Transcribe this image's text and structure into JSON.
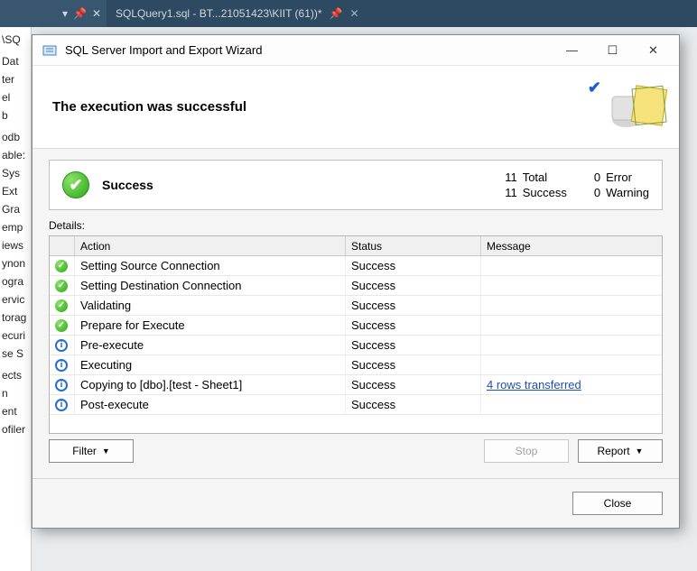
{
  "tabstrip": {
    "tab_label": "SQLQuery1.sql - BT...21051423\\KIIT (61))*"
  },
  "left_tree_fragments": [
    "\\SQ",
    "",
    "Dat",
    "ter",
    "el",
    "b",
    "",
    "odb",
    "able:",
    "Sys",
    "Ext",
    "Gra",
    "emp",
    "iews",
    "ynon",
    "ogra",
    "ervic",
    "torag",
    "ecuri",
    "se S",
    "",
    "ects",
    "n",
    "ent",
    "ofiler"
  ],
  "dialog": {
    "title": "SQL Server Import and Export Wizard",
    "banner_headline": "The execution was successful",
    "summary": {
      "label": "Success",
      "total_n": "11",
      "total_lbl": "Total",
      "success_n": "11",
      "success_lbl": "Success",
      "error_n": "0",
      "error_lbl": "Error",
      "warning_n": "0",
      "warning_lbl": "Warning"
    },
    "details_label": "Details:",
    "columns": {
      "c0": "",
      "c1": "Action",
      "c2": "Status",
      "c3": "Message"
    },
    "rows": [
      {
        "icon": "ok",
        "action": "Setting Source Connection",
        "status": "Success",
        "message": ""
      },
      {
        "icon": "ok",
        "action": "Setting Destination Connection",
        "status": "Success",
        "message": ""
      },
      {
        "icon": "ok",
        "action": "Validating",
        "status": "Success",
        "message": ""
      },
      {
        "icon": "ok",
        "action": "Prepare for Execute",
        "status": "Success",
        "message": ""
      },
      {
        "icon": "info",
        "action": "Pre-execute",
        "status": "Success",
        "message": ""
      },
      {
        "icon": "info",
        "action": "Executing",
        "status": "Success",
        "message": ""
      },
      {
        "icon": "info",
        "action": "Copying to [dbo].[test - Sheet1]",
        "status": "Success",
        "message": "4 rows transferred",
        "message_link": true
      },
      {
        "icon": "info",
        "action": "Post-execute",
        "status": "Success",
        "message": ""
      }
    ],
    "buttons": {
      "filter": "Filter",
      "stop": "Stop",
      "report": "Report",
      "close": "Close"
    }
  }
}
